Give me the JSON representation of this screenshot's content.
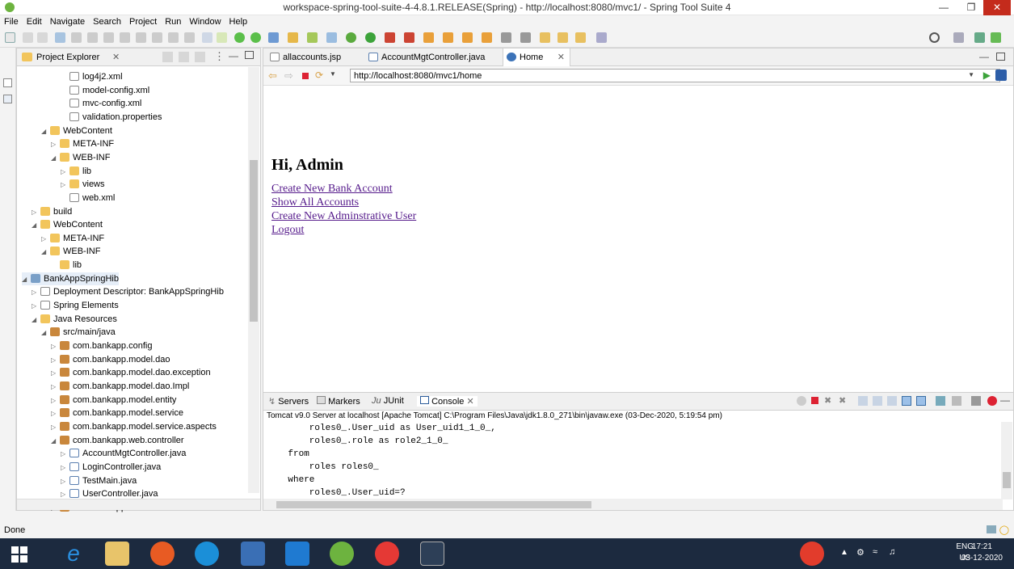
{
  "window": {
    "title": "workspace-spring-tool-suite-4-4.8.1.RELEASE(Spring) - http://localhost:8080/mvc1/ - Spring Tool Suite 4"
  },
  "menu": [
    "File",
    "Edit",
    "Navigate",
    "Search",
    "Project",
    "Run",
    "Window",
    "Help"
  ],
  "explorer": {
    "title": "Project Explorer",
    "items": [
      {
        "label": "log4j2.xml",
        "icon": "xml"
      },
      {
        "label": "model-config.xml",
        "icon": "xml"
      },
      {
        "label": "mvc-config.xml",
        "icon": "xml"
      },
      {
        "label": "validation.properties",
        "icon": "file"
      },
      {
        "label": "WebContent",
        "icon": "folder"
      },
      {
        "label": "META-INF",
        "icon": "folder"
      },
      {
        "label": "WEB-INF",
        "icon": "folder"
      },
      {
        "label": "lib",
        "icon": "folder"
      },
      {
        "label": "views",
        "icon": "folder"
      },
      {
        "label": "web.xml",
        "icon": "xml"
      },
      {
        "label": "build",
        "icon": "folder"
      },
      {
        "label": "WebContent",
        "icon": "folder"
      },
      {
        "label": "META-INF",
        "icon": "folder"
      },
      {
        "label": "WEB-INF",
        "icon": "folder"
      },
      {
        "label": "lib",
        "icon": "folder"
      },
      {
        "label": "BankAppSpringHib",
        "icon": "project"
      },
      {
        "label": "Deployment Descriptor: BankAppSpringHib",
        "icon": "file"
      },
      {
        "label": "Spring Elements",
        "icon": "file"
      },
      {
        "label": "Java Resources",
        "icon": "folder"
      },
      {
        "label": "src/main/java",
        "icon": "package"
      },
      {
        "label": "com.bankapp.config",
        "icon": "package"
      },
      {
        "label": "com.bankapp.model.dao",
        "icon": "package"
      },
      {
        "label": "com.bankapp.model.dao.exception",
        "icon": "package"
      },
      {
        "label": "com.bankapp.model.dao.Impl",
        "icon": "package"
      },
      {
        "label": "com.bankapp.model.entity",
        "icon": "package"
      },
      {
        "label": "com.bankapp.model.service",
        "icon": "package"
      },
      {
        "label": "com.bankapp.model.service.aspects",
        "icon": "package"
      },
      {
        "label": "com.bankapp.web.controller",
        "icon": "package"
      },
      {
        "label": "AccountMgtController.java",
        "icon": "java"
      },
      {
        "label": "LoginController.java",
        "icon": "java"
      },
      {
        "label": "TestMain.java",
        "icon": "java"
      },
      {
        "label": "UserController.java",
        "icon": "java"
      },
      {
        "label": "com.bankapp.web.formbeans",
        "icon": "package"
      }
    ]
  },
  "editor": {
    "tabs": [
      {
        "label": "allaccounts.jsp"
      },
      {
        "label": "AccountMgtController.java"
      },
      {
        "label": "Home"
      }
    ],
    "url": "http://localhost:8080/mvc1/home"
  },
  "page": {
    "heading": "Hi, Admin",
    "links": [
      "Create New Bank Account",
      "Show All Accounts",
      "Create New Adminstrative User",
      "Logout"
    ]
  },
  "console": {
    "tabs": [
      "Servers",
      "Markers",
      "JUnit",
      "Console"
    ],
    "description": "Tomcat v9.0 Server at localhost [Apache Tomcat] C:\\Program Files\\Java\\jdk1.8.0_271\\bin\\javaw.exe  (03-Dec-2020, 5:19:54 pm)",
    "lines": [
      "        roles0_.User_uid as User_uid1_1_0_,",
      "        roles0_.role as role2_1_0_",
      "    from",
      "        roles roles0_",
      "    where",
      "        roles0_.User_uid=?"
    ]
  },
  "status": {
    "text": "Done"
  },
  "taskbar": {
    "lang": "ENG",
    "region": "US",
    "time": "17:21",
    "date": "03-12-2020"
  }
}
